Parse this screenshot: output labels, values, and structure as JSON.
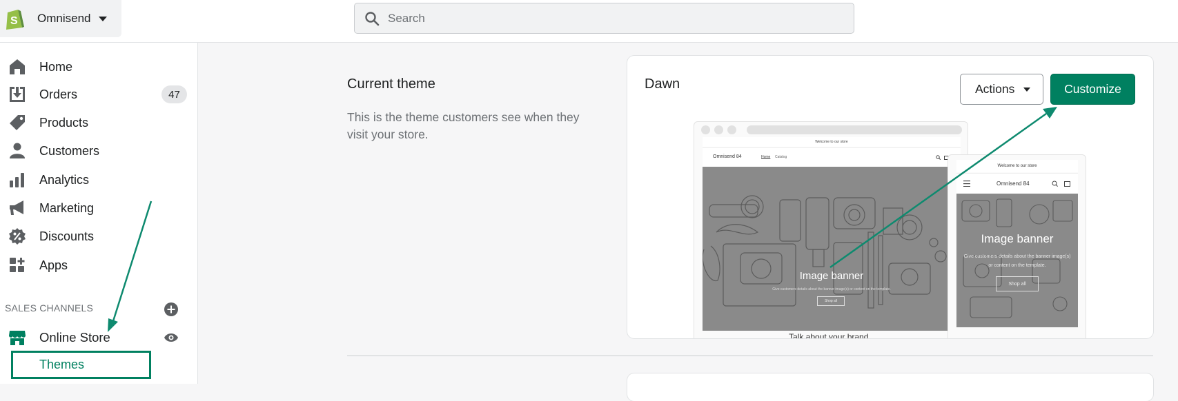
{
  "store": {
    "name": "Omnisend"
  },
  "search": {
    "placeholder": "Search"
  },
  "nav": {
    "items": [
      {
        "label": "Home",
        "icon": "home-icon"
      },
      {
        "label": "Orders",
        "icon": "orders-icon",
        "badge": "47"
      },
      {
        "label": "Products",
        "icon": "tag-icon"
      },
      {
        "label": "Customers",
        "icon": "person-icon"
      },
      {
        "label": "Analytics",
        "icon": "bar-chart-icon"
      },
      {
        "label": "Marketing",
        "icon": "megaphone-icon"
      },
      {
        "label": "Discounts",
        "icon": "discount-icon"
      },
      {
        "label": "Apps",
        "icon": "apps-icon"
      }
    ],
    "sales_channels_header": "SALES CHANNELS",
    "online_store": "Online Store",
    "themes": "Themes"
  },
  "current_theme": {
    "title": "Current theme",
    "description": "This is the theme customers see when they visit your store."
  },
  "theme_card": {
    "name": "Dawn",
    "actions_label": "Actions",
    "customize_label": "Customize"
  },
  "preview": {
    "desktop_announcement": "Welcome to our store",
    "desktop_store_name": "Omnisend 84",
    "desktop_link_home": "Home",
    "desktop_link_catalog": "Catalog",
    "desktop_banner_title": "Image banner",
    "desktop_banner_text": "Give customers details about the banner image(s) or content on the template.",
    "desktop_shop_all": "Shop all",
    "desktop_footer_text": "Talk about your brand",
    "mobile_announcement": "Welcome to our store",
    "mobile_store_name": "Omnisend 84",
    "mobile_banner_title": "Image banner",
    "mobile_banner_text": "Give customers details about the banner image(s) or content on the template.",
    "mobile_shop_all": "Shop all"
  },
  "colors": {
    "accent": "#008060",
    "annotation": "#0e8a6f"
  }
}
